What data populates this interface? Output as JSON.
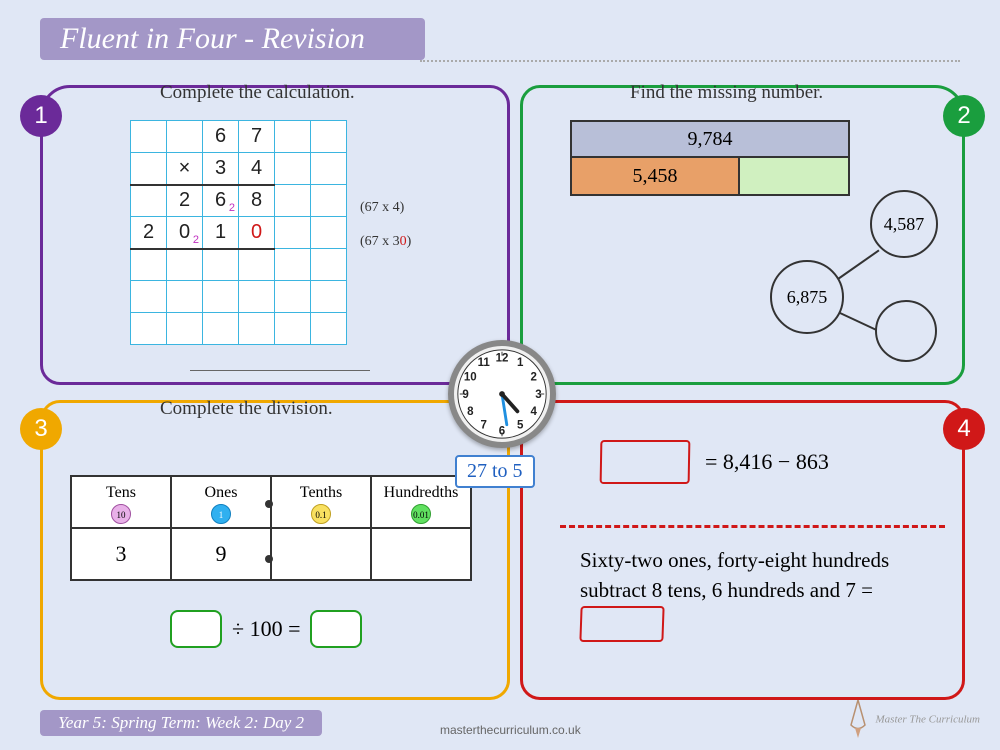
{
  "title": "Fluent in Four - Revision",
  "footer": "Year 5: Spring Term: Week 2: Day 2",
  "website": "masterthecurriculum.co.uk",
  "logo_text": "Master The Curriculum",
  "badges": {
    "n1": "1",
    "n2": "2",
    "n3": "3",
    "n4": "4"
  },
  "q1": {
    "instruction": "Complete the calculation.",
    "grid": {
      "r1": [
        "",
        "",
        "6",
        "7",
        "",
        ""
      ],
      "r2": [
        "",
        "×",
        "3",
        "4",
        "",
        ""
      ],
      "r3": [
        "",
        "2",
        "6",
        "8",
        "",
        ""
      ],
      "r3_sub": "2",
      "r4": [
        "2",
        "0",
        "1",
        "0",
        "",
        ""
      ],
      "r4_sub": "2",
      "r4_red": "0"
    },
    "annot1": "(67 x 4)",
    "annot2_a": "(67 x ",
    "annot2_b": "3",
    "annot2_c": "0",
    "annot2_d": ")"
  },
  "q2": {
    "instruction": "Find the missing number.",
    "bar_total": "9,784",
    "bar_part": "5,458",
    "whole": "6,875",
    "part1": "4,587"
  },
  "clock": {
    "label": "27 to 5",
    "numbers": [
      "12",
      "1",
      "2",
      "3",
      "4",
      "5",
      "6",
      "7",
      "8",
      "9",
      "10",
      "11"
    ]
  },
  "q3": {
    "instruction": "Complete the division.",
    "headers": {
      "tens": "Tens",
      "ones": "Ones",
      "tenths": "Tenths",
      "hundredths": "Hundredths"
    },
    "chips": {
      "tens": "10",
      "ones": "1",
      "tenths": "0.1",
      "hundredths": "0.01"
    },
    "row": {
      "tens": "3",
      "ones": "9",
      "tenths": "",
      "hundredths": ""
    },
    "equation": "÷ 100 ="
  },
  "q4": {
    "equation": "= 8,416 − 863",
    "words": "Sixty-two ones, forty-eight hundreds subtract 8 tens, 6 hundreds and 7 ="
  }
}
